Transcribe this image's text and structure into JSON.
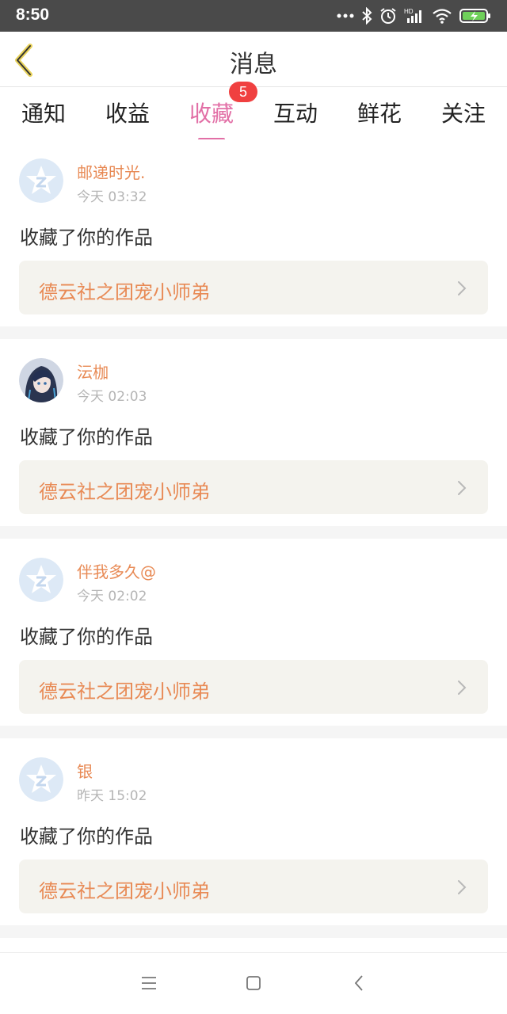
{
  "status_bar": {
    "time": "8:50",
    "icons": [
      "more-dots-icon",
      "bluetooth-icon",
      "alarm-icon",
      "hd-signal-icon",
      "wifi-icon",
      "battery-charging-icon"
    ]
  },
  "header": {
    "title": "消息",
    "back_icon": "back-chevron-icon"
  },
  "tabs": [
    {
      "label": "通知",
      "active": false
    },
    {
      "label": "收益",
      "active": false
    },
    {
      "label": "收藏",
      "active": true,
      "badge": "5"
    },
    {
      "label": "互动",
      "active": false
    },
    {
      "label": "鲜花",
      "active": false
    },
    {
      "label": "关注",
      "active": false
    }
  ],
  "colors": {
    "accent": "#e26fa6",
    "name_orange": "#e88a55",
    "badge_red": "#f04040",
    "card_bg": "#f4f3ee"
  },
  "messages": [
    {
      "user": "邮递时光.",
      "time": "今天 03:32",
      "action": "收藏了你的作品",
      "work_title": "德云社之团宠小师弟",
      "avatar": "default-star-avatar"
    },
    {
      "user": "沄枷",
      "time": "今天 02:03",
      "action": "收藏了你的作品",
      "work_title": "德云社之团宠小师弟",
      "avatar": "anime-girl-avatar"
    },
    {
      "user": "伴我多久@",
      "time": "今天 02:02",
      "action": "收藏了你的作品",
      "work_title": "德云社之团宠小师弟",
      "avatar": "default-star-avatar"
    },
    {
      "user": "银",
      "time": "昨天 15:02",
      "action": "收藏了你的作品",
      "work_title": "德云社之团宠小师弟",
      "avatar": "default-star-avatar"
    }
  ],
  "nav_bar": {
    "buttons": [
      "menu-icon",
      "home-square-icon",
      "back-icon"
    ]
  }
}
